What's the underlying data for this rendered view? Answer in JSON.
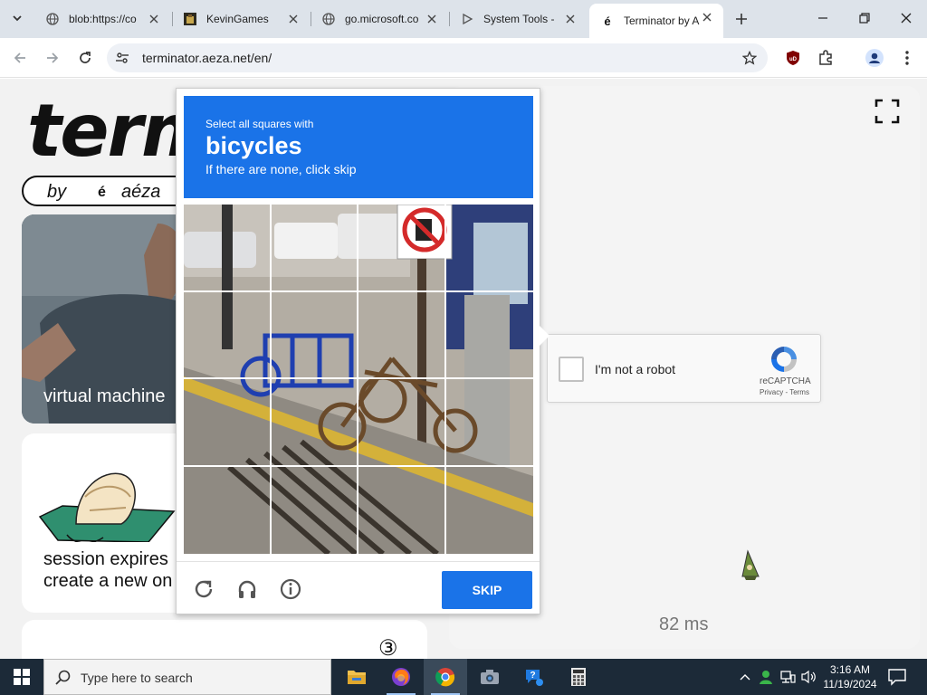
{
  "browser": {
    "tabs": [
      {
        "title": "blob:https://co",
        "icon": "globe-icon"
      },
      {
        "title": "KevinGames",
        "icon": "kevingames-favicon"
      },
      {
        "title": "go.microsoft.co",
        "icon": "globe-icon"
      },
      {
        "title": "System Tools - ",
        "icon": "play-icon"
      },
      {
        "title": "Terminator by A",
        "icon": "aeza-favicon",
        "active": true
      }
    ],
    "address_bar": {
      "url": "terminator.aeza.net/en/"
    }
  },
  "page": {
    "logo_text": "term",
    "byline": {
      "by": "by",
      "mark": "é",
      "brand": "aéza"
    },
    "vm_card_label": "virtual machine",
    "session_card": {
      "line1": "session expires",
      "line2": "create a new on"
    },
    "latency": "82 ms",
    "step_badge": "③"
  },
  "recaptcha": {
    "checkbox_label": "I'm not a robot",
    "brand": "reCAPTCHA",
    "links": "Privacy - Terms"
  },
  "challenge": {
    "instruction_line1": "Select all squares with",
    "object": "bicycles",
    "instruction_line3": "If there are none, click skip",
    "skip_label": "SKIP",
    "grid_size": "4x4"
  },
  "taskbar": {
    "search_placeholder": "Type here to search",
    "time": "3:16 AM",
    "date": "11/19/2024",
    "apps": [
      "file-explorer-icon",
      "firefox-icon",
      "chrome-icon",
      "camera-icon",
      "help-icon",
      "calculator-icon"
    ]
  },
  "colors": {
    "accent_blue": "#1a73e8",
    "taskbar": "#1c2a38",
    "tabstrip": "#dde3ea"
  }
}
